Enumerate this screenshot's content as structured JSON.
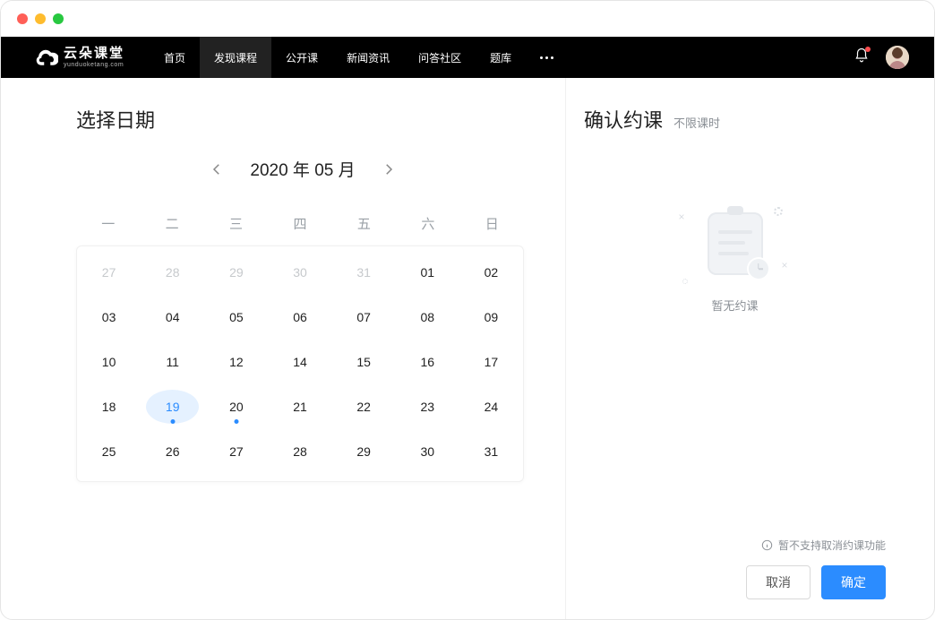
{
  "logo": {
    "main": "云朵课堂",
    "sub": "yunduoketang.com"
  },
  "nav": {
    "items": [
      {
        "label": "首页",
        "key": "home"
      },
      {
        "label": "发现课程",
        "key": "discover",
        "active": true
      },
      {
        "label": "公开课",
        "key": "open"
      },
      {
        "label": "新闻资讯",
        "key": "news"
      },
      {
        "label": "问答社区",
        "key": "qa"
      },
      {
        "label": "题库",
        "key": "bank"
      }
    ]
  },
  "left": {
    "title": "选择日期",
    "month_label": "2020 年 05 月",
    "weekdays": [
      "一",
      "二",
      "三",
      "四",
      "五",
      "六",
      "日"
    ],
    "weeks": [
      [
        {
          "d": "27",
          "other": true
        },
        {
          "d": "28",
          "other": true
        },
        {
          "d": "29",
          "other": true
        },
        {
          "d": "30",
          "other": true
        },
        {
          "d": "31",
          "other": true
        },
        {
          "d": "01"
        },
        {
          "d": "02"
        }
      ],
      [
        {
          "d": "03"
        },
        {
          "d": "04"
        },
        {
          "d": "05"
        },
        {
          "d": "06"
        },
        {
          "d": "07"
        },
        {
          "d": "08"
        },
        {
          "d": "09"
        }
      ],
      [
        {
          "d": "10"
        },
        {
          "d": "11"
        },
        {
          "d": "12"
        },
        {
          "d": "14"
        },
        {
          "d": "15"
        },
        {
          "d": "16"
        },
        {
          "d": "17"
        }
      ],
      [
        {
          "d": "18"
        },
        {
          "d": "19",
          "selected": true,
          "mark": true
        },
        {
          "d": "20",
          "mark": true
        },
        {
          "d": "21"
        },
        {
          "d": "22"
        },
        {
          "d": "23"
        },
        {
          "d": "24"
        }
      ],
      [
        {
          "d": "25"
        },
        {
          "d": "26"
        },
        {
          "d": "27"
        },
        {
          "d": "28"
        },
        {
          "d": "29"
        },
        {
          "d": "30"
        },
        {
          "d": "31"
        }
      ]
    ]
  },
  "right": {
    "title": "确认约课",
    "subtitle": "不限课时",
    "empty_text": "暂无约课",
    "notice": "暂不支持取消约课功能",
    "cancel": "取消",
    "confirm": "确定"
  }
}
